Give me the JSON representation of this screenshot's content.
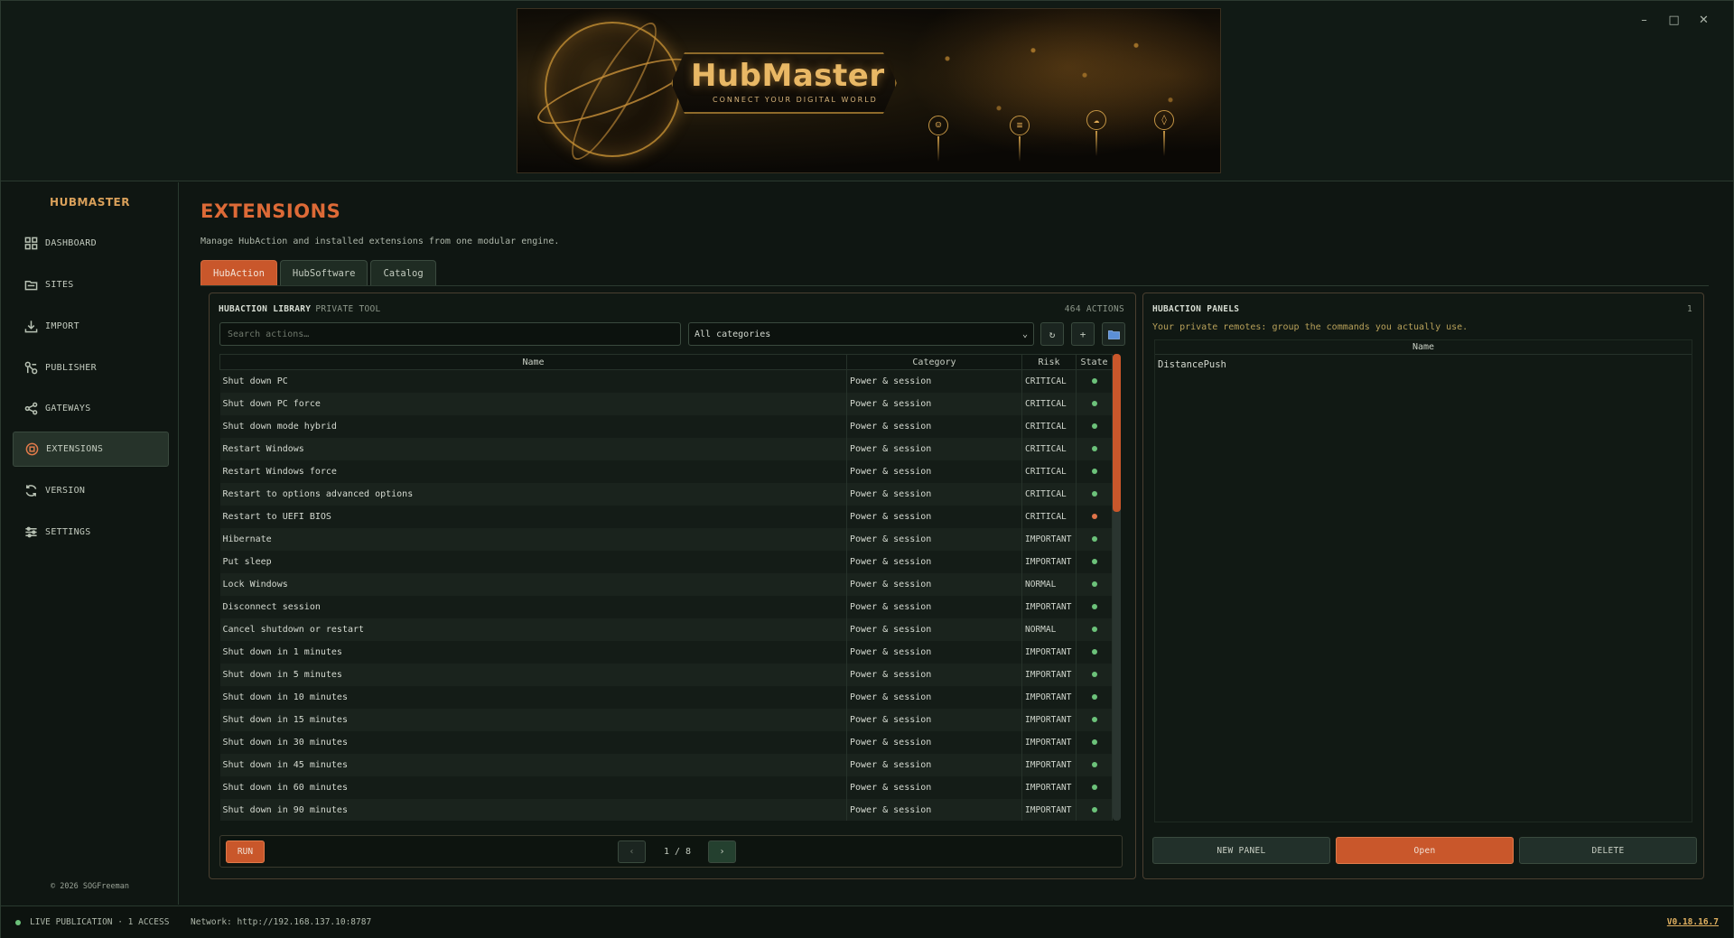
{
  "window": {
    "minimize": "–",
    "maximize": "□",
    "close": "✕"
  },
  "banner": {
    "logo": "HubMaster",
    "tagline": "CONNECT YOUR DIGITAL WORLD"
  },
  "sidebar": {
    "brand": "HUBMASTER",
    "items": [
      {
        "label": "DASHBOARD",
        "icon": "grid-icon"
      },
      {
        "label": "SITES",
        "icon": "folder-icon"
      },
      {
        "label": "IMPORT",
        "icon": "download-icon"
      },
      {
        "label": "PUBLISHER",
        "icon": "publish-icon"
      },
      {
        "label": "GATEWAYS",
        "icon": "share-icon"
      },
      {
        "label": "EXTENSIONS",
        "icon": "extension-icon",
        "active": true
      },
      {
        "label": "VERSION",
        "icon": "sync-icon"
      },
      {
        "label": "SETTINGS",
        "icon": "sliders-icon"
      }
    ],
    "copyright": "© 2026 SOGFreeman"
  },
  "page": {
    "title": "EXTENSIONS",
    "subtitle": "Manage HubAction and installed extensions from one modular engine.",
    "tabs": [
      {
        "label": "HubAction",
        "active": true
      },
      {
        "label": "HubSoftware"
      },
      {
        "label": "Catalog"
      }
    ]
  },
  "library": {
    "title": "HUBACTION LIBRARY",
    "title_tag": "PRIVATE TOOL",
    "count": "464 ACTIONS",
    "search_placeholder": "Search actions…",
    "category_selected": "All categories",
    "buttons": {
      "refresh": "↻",
      "add": "+",
      "folder": "folder-icon"
    },
    "columns": [
      "Name",
      "Category",
      "Risk",
      "State"
    ],
    "rows": [
      {
        "name": "Shut down PC",
        "category": "Power & session",
        "risk": "CRITICAL",
        "state": "ok"
      },
      {
        "name": "Shut down PC force",
        "category": "Power & session",
        "risk": "CRITICAL",
        "state": "ok"
      },
      {
        "name": "Shut down mode hybrid",
        "category": "Power & session",
        "risk": "CRITICAL",
        "state": "ok"
      },
      {
        "name": "Restart Windows",
        "category": "Power & session",
        "risk": "CRITICAL",
        "state": "ok"
      },
      {
        "name": "Restart Windows force",
        "category": "Power & session",
        "risk": "CRITICAL",
        "state": "ok"
      },
      {
        "name": "Restart to options advanced options",
        "category": "Power & session",
        "risk": "CRITICAL",
        "state": "ok"
      },
      {
        "name": "Restart to UEFI BIOS",
        "category": "Power & session",
        "risk": "CRITICAL",
        "state": "warn"
      },
      {
        "name": "Hibernate",
        "category": "Power & session",
        "risk": "IMPORTANT",
        "state": "ok"
      },
      {
        "name": "Put sleep",
        "category": "Power & session",
        "risk": "IMPORTANT",
        "state": "ok"
      },
      {
        "name": "Lock Windows",
        "category": "Power & session",
        "risk": "NORMAL",
        "state": "ok"
      },
      {
        "name": "Disconnect session",
        "category": "Power & session",
        "risk": "IMPORTANT",
        "state": "ok"
      },
      {
        "name": "Cancel shutdown or restart",
        "category": "Power & session",
        "risk": "NORMAL",
        "state": "ok"
      },
      {
        "name": "Shut down in 1 minutes",
        "category": "Power & session",
        "risk": "IMPORTANT",
        "state": "ok"
      },
      {
        "name": "Shut down in 5 minutes",
        "category": "Power & session",
        "risk": "IMPORTANT",
        "state": "ok"
      },
      {
        "name": "Shut down in 10 minutes",
        "category": "Power & session",
        "risk": "IMPORTANT",
        "state": "ok"
      },
      {
        "name": "Shut down in 15 minutes",
        "category": "Power & session",
        "risk": "IMPORTANT",
        "state": "ok"
      },
      {
        "name": "Shut down in 30 minutes",
        "category": "Power & session",
        "risk": "IMPORTANT",
        "state": "ok"
      },
      {
        "name": "Shut down in 45 minutes",
        "category": "Power & session",
        "risk": "IMPORTANT",
        "state": "ok"
      },
      {
        "name": "Shut down in 60 minutes",
        "category": "Power & session",
        "risk": "IMPORTANT",
        "state": "ok"
      },
      {
        "name": "Shut down in 90 minutes",
        "category": "Power & session",
        "risk": "IMPORTANT",
        "state": "ok"
      }
    ],
    "run_label": "RUN",
    "prev": "‹",
    "next": "›",
    "page_label": "1 / 8"
  },
  "panels": {
    "title": "HUBACTION PANELS",
    "count": "1",
    "subtitle": "Your private remotes: group the commands you actually use.",
    "column": "Name",
    "rows": [
      "DistancePush"
    ],
    "new_label": "NEW PANEL",
    "open_label": "Open",
    "delete_label": "DELETE"
  },
  "status": {
    "live": "LIVE PUBLICATION · 1 ACCESS",
    "network": "Network: http://192.168.137.10:8787",
    "version": "V0.18.16.7"
  },
  "colors": {
    "accent": "#c9572b",
    "title": "#dd6a37",
    "ok": "#6cc27a",
    "warn": "#e0744a"
  }
}
